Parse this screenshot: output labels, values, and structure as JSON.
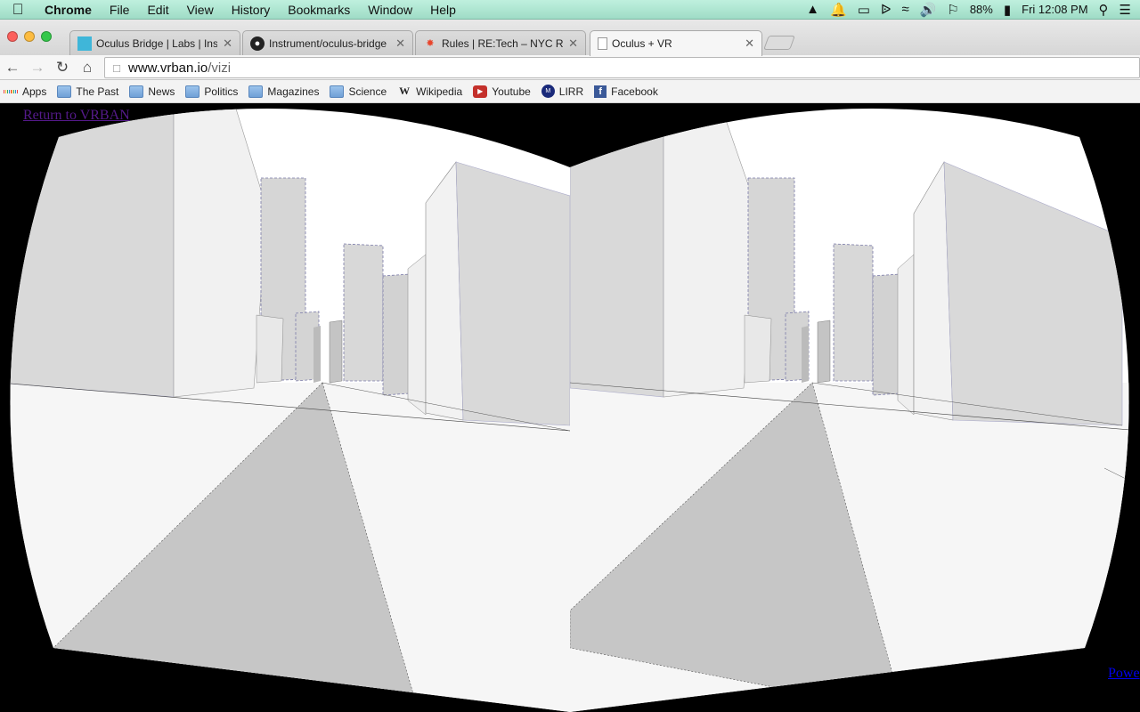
{
  "menubar": {
    "app": "Chrome",
    "items": [
      "File",
      "Edit",
      "View",
      "History",
      "Bookmarks",
      "Window",
      "Help"
    ],
    "battery": "88%",
    "clock": "Fri 12:08 PM"
  },
  "tabs": [
    {
      "title": "Oculus Bridge | Labs | Inst",
      "icon": "instrument-favicon"
    },
    {
      "title": "Instrument/oculus-bridge",
      "icon": "github-favicon"
    },
    {
      "title": "Rules | RE:Tech – NYC Real",
      "icon": "retech-favicon"
    },
    {
      "title": "Oculus + VR",
      "icon": "blank-page-favicon"
    }
  ],
  "url": {
    "host": "www.vrban.io",
    "path": "/vizi"
  },
  "bookmarks": [
    {
      "label": "Apps",
      "icon": "apps-grid-icon"
    },
    {
      "label": "The Past",
      "icon": "folder-icon"
    },
    {
      "label": "News",
      "icon": "folder-icon"
    },
    {
      "label": "Politics",
      "icon": "folder-icon"
    },
    {
      "label": "Magazines",
      "icon": "folder-icon"
    },
    {
      "label": "Science",
      "icon": "folder-icon"
    },
    {
      "label": "Wikipedia",
      "icon": "wikipedia-icon"
    },
    {
      "label": "Youtube",
      "icon": "youtube-icon"
    },
    {
      "label": "LIRR",
      "icon": "mta-icon"
    },
    {
      "label": "Facebook",
      "icon": "facebook-icon"
    }
  ],
  "page": {
    "return_link": "Return to VRBAN",
    "powered_link": "Powe"
  },
  "colors": {
    "menubar": "#bff0de",
    "visited_link": "#551a8b",
    "link": "#0000ee",
    "vr_background": "#000000"
  }
}
